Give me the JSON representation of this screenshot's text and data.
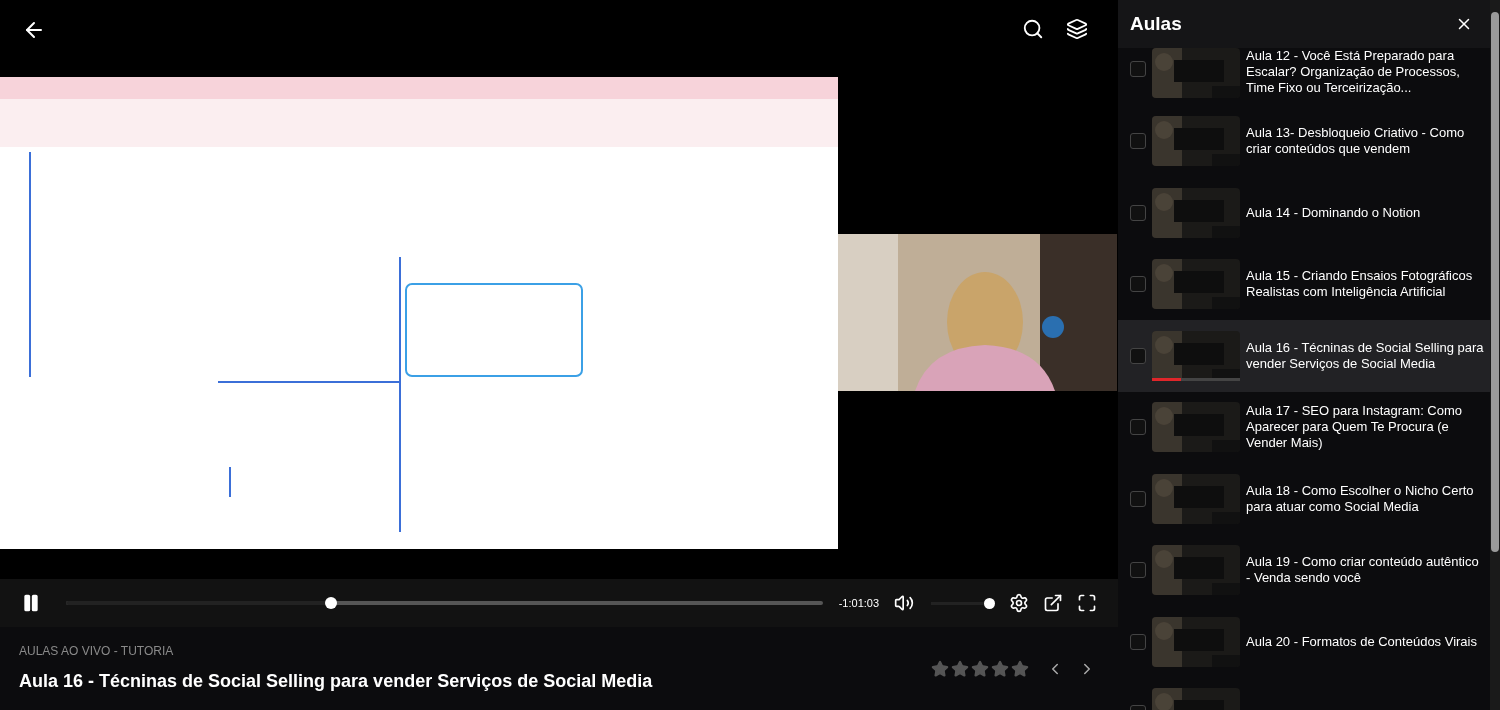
{
  "player": {
    "progress": {
      "level": 0.35
    },
    "time_remaining": "-1:01:03",
    "volume": {
      "level": 1
    }
  },
  "lesson": {
    "course": "AULAS AO VIVO - TUTORIA",
    "title": "Aula 16 - Técninas de Social Selling para vender Serviços de Social Media",
    "stars": 0
  },
  "sidebar": {
    "title": "Aulas",
    "items": [
      {
        "title": "Aula 12 - Você Está Preparado para Escalar? Organização de Processos, Time Fixo ou Terceirização...",
        "checked": false,
        "selected": false
      },
      {
        "title": "Aula 13- Desbloqueio Criativo - Como criar conteúdos que vendem",
        "checked": false,
        "selected": false
      },
      {
        "title": "Aula 14 - Dominando o Notion",
        "checked": false,
        "selected": false
      },
      {
        "title": "Aula 15 - Criando Ensaios Fotográficos Realistas com Inteligência Artificial",
        "checked": false,
        "selected": false
      },
      {
        "title": "Aula 16 - Técninas de Social Selling para vender Serviços de Social Media",
        "checked": false,
        "selected": true,
        "level": 0.33
      },
      {
        "title": "Aula 17 - SEO para Instagram: Como Aparecer para Quem Te Procura (e Vender Mais)",
        "checked": false,
        "selected": false
      },
      {
        "title": "Aula 18 - Como Escolher o Nicho Certo para atuar como Social Media",
        "checked": false,
        "selected": false
      },
      {
        "title": "Aula 19 - Como criar conteúdo autêntico - Venda sendo você",
        "checked": false,
        "selected": false
      },
      {
        "title": "Aula 20 - Formatos de Conteúdos Virais",
        "checked": false,
        "selected": false
      },
      {
        "checked": false,
        "selected": false
      }
    ]
  }
}
